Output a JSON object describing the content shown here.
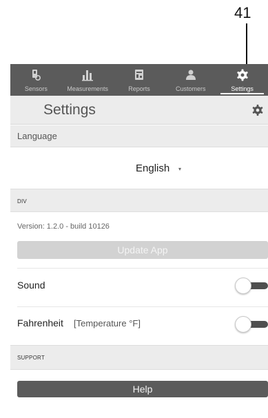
{
  "callout": {
    "number": "41"
  },
  "tabs": [
    {
      "label": "Sensors",
      "icon": "sensor-icon",
      "active": false
    },
    {
      "label": "Measurements",
      "icon": "bar-chart-icon",
      "active": false
    },
    {
      "label": "Reports",
      "icon": "report-icon",
      "active": false
    },
    {
      "label": "Customers",
      "icon": "customer-icon",
      "active": false
    },
    {
      "label": "Settings",
      "icon": "gear-icon",
      "active": true
    }
  ],
  "header": {
    "title": "Settings",
    "icon": "gear-icon"
  },
  "language": {
    "section_label": "Language",
    "selected": "English",
    "caret": "▾"
  },
  "div_section": {
    "label": "DIV",
    "version": "Version: 1.2.0 - build 10126",
    "update_button": "Update App"
  },
  "sound": {
    "label": "Sound",
    "enabled": false
  },
  "fahrenheit": {
    "label": "Fahrenheit",
    "sublabel": "[Temperature °F]",
    "enabled": false
  },
  "support": {
    "label": "SUPPORT",
    "help_button": "Help"
  },
  "colors": {
    "tabbar_bg": "#5b5b5b",
    "header_bg": "#ececec",
    "button_dark": "#5b5b5b",
    "button_disabled": "#d2d2d2",
    "toggle_track": "#4f4f4f"
  }
}
